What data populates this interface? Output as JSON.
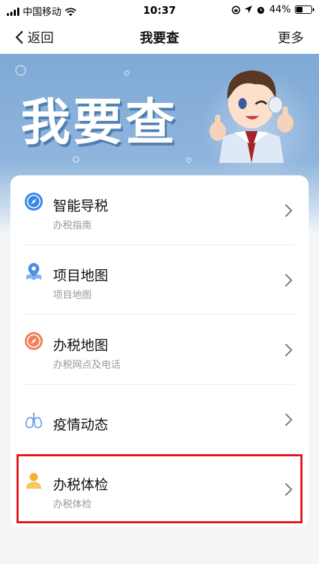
{
  "status_bar": {
    "carrier": "中国移动",
    "time": "10:37",
    "battery_text": "44%",
    "battery_level": 0.44
  },
  "nav": {
    "back_label": "返回",
    "title": "我要查",
    "more_label": "更多"
  },
  "banner": {
    "title": "我要查"
  },
  "menu": [
    {
      "title": "智能导税",
      "subtitle": "办税指南",
      "icon": "compass-icon",
      "color": "#3a86e8"
    },
    {
      "title": "项目地图",
      "subtitle": "项目地图",
      "icon": "map-location-icon",
      "color": "#4a8fe0"
    },
    {
      "title": "办税地图",
      "subtitle": "办税网点及电话",
      "icon": "compass-orange-icon",
      "color": "#f0805a"
    },
    {
      "title": "疫情动态",
      "subtitle": "",
      "icon": "lungs-icon",
      "color": "#6aa0e8"
    },
    {
      "title": "办税体检",
      "subtitle": "办税体检",
      "icon": "person-icon",
      "color": "#f3b233"
    }
  ],
  "highlight_color": "#e3121b"
}
